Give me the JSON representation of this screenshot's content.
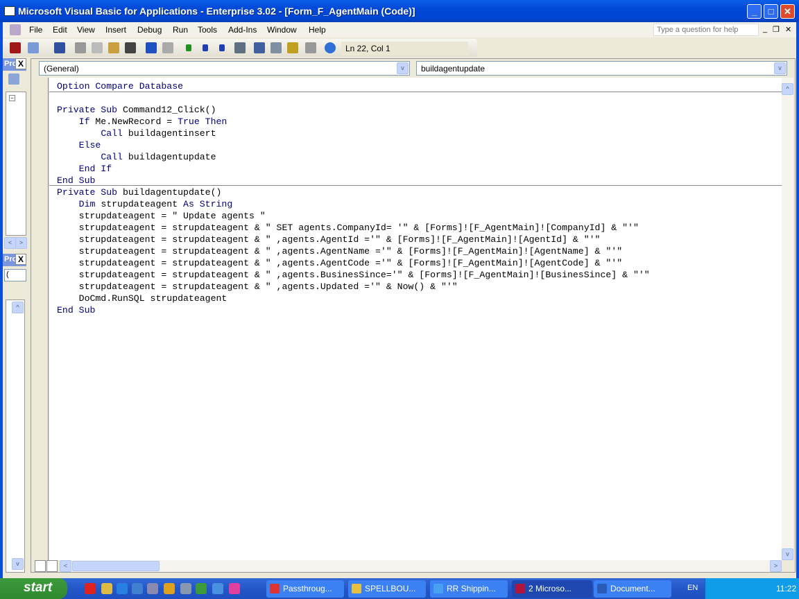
{
  "window": {
    "title": "Microsoft Visual Basic for Applications - Enterprise 3.02 - [Form_F_AgentMain (Code)]",
    "minimize": "_",
    "maximize": "□",
    "close": "✕"
  },
  "menu": [
    "File",
    "Edit",
    "View",
    "Insert",
    "Debug",
    "Run",
    "Tools",
    "Add-Ins",
    "Window",
    "Help"
  ],
  "help_placeholder": "Type a question for help",
  "mdi_controls": [
    "_",
    "❐",
    "✕"
  ],
  "toolbar": {
    "position": "Ln 22, Col 1",
    "icons": [
      "access-icon",
      "insert-module-icon",
      "save-icon",
      "cut-icon",
      "copy-icon",
      "paste-icon",
      "find-icon",
      "undo-icon",
      "redo-icon",
      "run-icon",
      "break-icon",
      "reset-icon",
      "design-mode-icon",
      "project-explorer-icon",
      "properties-icon",
      "object-browser-icon",
      "toolbox-icon",
      "help-icon"
    ]
  },
  "project_panel": {
    "title": "Pro",
    "close": "X"
  },
  "properties_panel": {
    "title": "Pro",
    "close": "X",
    "combo": "("
  },
  "code_window": {
    "object_combo": "(General)",
    "procedure_combo": "buildagentupdate",
    "lines": [
      [
        {
          "t": "Option Compare Database",
          "k": 1
        }
      ],
      [],
      [
        {
          "t": "Private Sub",
          "k": 1
        },
        {
          "t": " Command12_Click()"
        }
      ],
      [
        {
          "t": "    "
        },
        {
          "t": "If",
          "k": 1
        },
        {
          "t": " Me.NewRecord = "
        },
        {
          "t": "True Then",
          "k": 1
        }
      ],
      [
        {
          "t": "        "
        },
        {
          "t": "Call",
          "k": 1
        },
        {
          "t": " buildagentinsert"
        }
      ],
      [
        {
          "t": "    "
        },
        {
          "t": "Else",
          "k": 1
        }
      ],
      [
        {
          "t": "        "
        },
        {
          "t": "Call",
          "k": 1
        },
        {
          "t": " buildagentupdate"
        }
      ],
      [
        {
          "t": "    "
        },
        {
          "t": "End If",
          "k": 1
        }
      ],
      [
        {
          "t": "End Sub",
          "k": 1
        }
      ],
      [
        {
          "t": "Private Sub",
          "k": 1
        },
        {
          "t": " buildagentupdate()"
        }
      ],
      [
        {
          "t": "    "
        },
        {
          "t": "Dim",
          "k": 1
        },
        {
          "t": " strupdateagent "
        },
        {
          "t": "As String",
          "k": 1
        }
      ],
      [
        {
          "t": "    strupdateagent = \" Update agents \""
        }
      ],
      [
        {
          "t": "    strupdateagent = strupdateagent & \" SET agents.CompanyId= '\" & [Forms]![F_AgentMain]![CompanyId] & \"'\""
        }
      ],
      [
        {
          "t": "    strupdateagent = strupdateagent & \" ,agents.AgentId ='\" & [Forms]![F_AgentMain]![AgentId] & \"'\""
        }
      ],
      [
        {
          "t": "    strupdateagent = strupdateagent & \" ,agents.AgentName ='\" & [Forms]![F_AgentMain]![AgentName] & \"'\""
        }
      ],
      [
        {
          "t": "    strupdateagent = strupdateagent & \" ,agents.AgentCode ='\" & [Forms]![F_AgentMain]![AgentCode] & \"'\""
        }
      ],
      [
        {
          "t": "    strupdateagent = strupdateagent & \" ,agents.BusinesSince='\" & [Forms]![F_AgentMain]![BusinesSince] & \"'\""
        }
      ],
      [
        {
          "t": "    strupdateagent = strupdateagent & \" ,agents.Updated ='\" & Now() & \"'\""
        }
      ],
      [
        {
          "t": "    DoCmd.RunSQL strupdateagent"
        }
      ],
      [
        {
          "t": "End Sub",
          "k": 1
        }
      ]
    ]
  },
  "taskbar": {
    "start": "start",
    "tasks": [
      {
        "label": "Passthroug...",
        "icon": "chrome-icon"
      },
      {
        "label": "SPELLBOU...",
        "icon": "folder-icon"
      },
      {
        "label": "RR Shippin...",
        "icon": "ie-icon"
      },
      {
        "label": "2 Microso...",
        "icon": "access-icon",
        "active": true
      },
      {
        "label": "Document...",
        "icon": "word-icon"
      }
    ],
    "lang": "EN",
    "clock": "11:22"
  }
}
